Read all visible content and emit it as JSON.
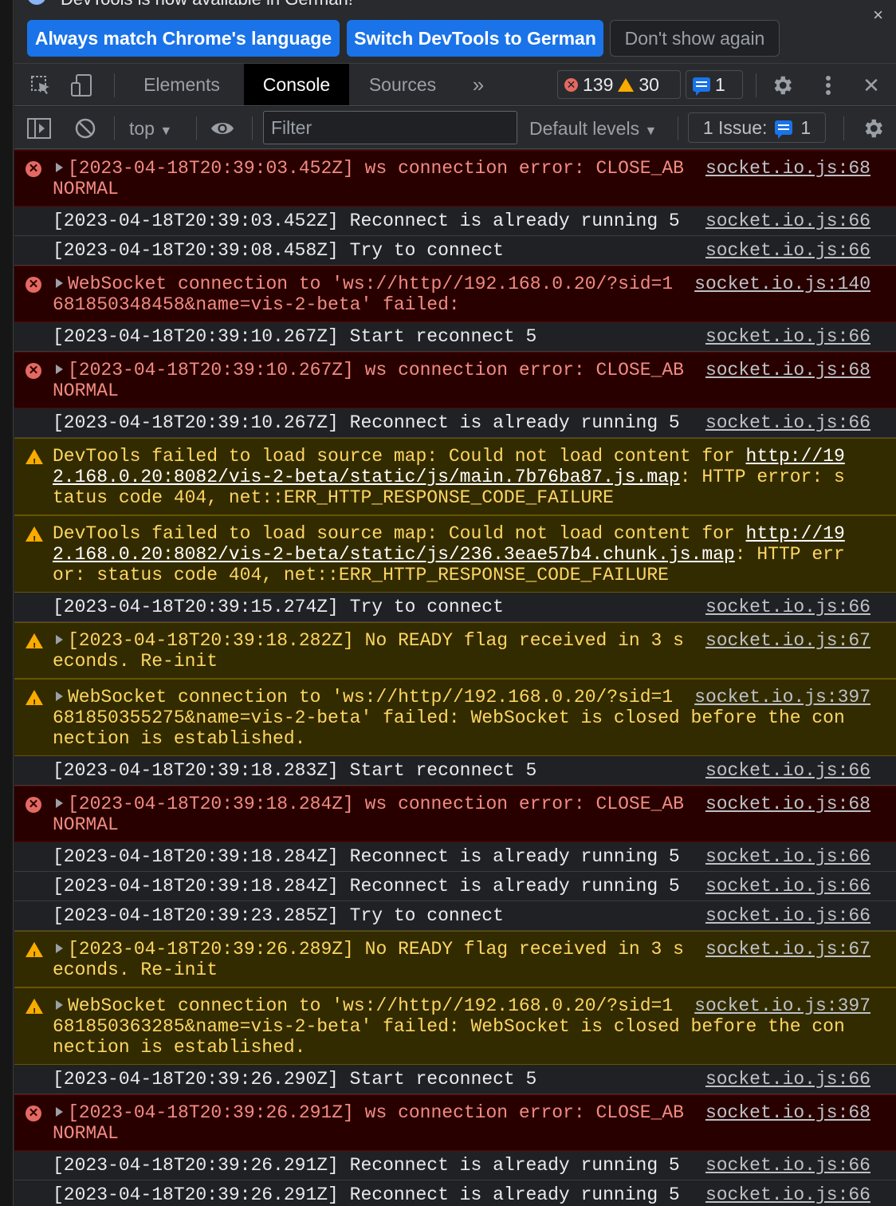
{
  "infobar": {
    "message": "DevTools is now available in German!",
    "buttons": {
      "match": "Always match Chrome's language",
      "switch": "Switch DevTools to German",
      "dismiss": "Don't show again"
    },
    "close_glyph": "×"
  },
  "toolbar": {
    "tabs": [
      "Elements",
      "Console",
      "Sources"
    ],
    "more_tabs_glyph": "»",
    "error_count": "139",
    "warning_count": "30",
    "issue_count": "1",
    "close_glyph": "✕"
  },
  "console_toolbar": {
    "context": "top",
    "filter_placeholder": "Filter",
    "levels": "Default levels",
    "issues_label": "1 Issue:",
    "issues_count": "1"
  },
  "colors": {
    "error_bg": "#290000",
    "error_text": "#f28b82",
    "warning_bg": "#332b00",
    "warning_text": "#fdd663",
    "accent": "#1a73e8"
  },
  "messages": [
    {
      "level": "error",
      "expandable": true,
      "text": "[2023-04-18T20:39:03.452Z] ws connection error: CLOSE_ABNORMAL",
      "source": "socket.io.js:68"
    },
    {
      "level": "log",
      "expandable": false,
      "text": "[2023-04-18T20:39:03.452Z] Reconnect is already running 5",
      "source": "socket.io.js:66"
    },
    {
      "level": "log",
      "expandable": false,
      "text": "[2023-04-18T20:39:08.458Z] Try to connect",
      "source": "socket.io.js:66"
    },
    {
      "level": "error",
      "expandable": true,
      "text": "WebSocket connection to 'ws://http//192.168.0.20/?sid=1681850348458&name=vis-2-beta' failed:",
      "source": "socket.io.js:140"
    },
    {
      "level": "log",
      "expandable": false,
      "text": "[2023-04-18T20:39:10.267Z] Start reconnect 5",
      "source": "socket.io.js:66"
    },
    {
      "level": "error",
      "expandable": true,
      "text": "[2023-04-18T20:39:10.267Z] ws connection error: CLOSE_ABNORMAL",
      "source": "socket.io.js:68"
    },
    {
      "level": "log",
      "expandable": false,
      "text": "[2023-04-18T20:39:10.267Z] Reconnect is already running 5",
      "source": "socket.io.js:66"
    },
    {
      "level": "warning",
      "expandable": false,
      "text": "DevTools failed to load source map: Could not load content for ",
      "link": "http://192.168.0.20:8082/vis-2-beta/static/js/main.7b76ba87.js.map",
      "suffix": ": HTTP error: status code 404, net::ERR_HTTP_RESPONSE_CODE_FAILURE",
      "source": ""
    },
    {
      "level": "warning",
      "expandable": false,
      "text": "DevTools failed to load source map: Could not load content for ",
      "link": "http://192.168.0.20:8082/vis-2-beta/static/js/236.3eae57b4.chunk.js.map",
      "suffix": ": HTTP error: status code 404, net::ERR_HTTP_RESPONSE_CODE_FAILURE",
      "source": ""
    },
    {
      "level": "log",
      "expandable": false,
      "text": "[2023-04-18T20:39:15.274Z] Try to connect",
      "source": "socket.io.js:66"
    },
    {
      "level": "warning",
      "expandable": true,
      "text": "[2023-04-18T20:39:18.282Z] No READY flag received in 3 seconds. Re-init",
      "source": "socket.io.js:67"
    },
    {
      "level": "warning",
      "expandable": true,
      "text": "WebSocket connection to 'ws://http//192.168.0.20/?sid=1681850355275&name=vis-2-beta' failed: WebSocket is closed before the connection is established.",
      "source": "socket.io.js:397"
    },
    {
      "level": "log",
      "expandable": false,
      "text": "[2023-04-18T20:39:18.283Z] Start reconnect 5",
      "source": "socket.io.js:66"
    },
    {
      "level": "error",
      "expandable": true,
      "text": "[2023-04-18T20:39:18.284Z] ws connection error: CLOSE_ABNORMAL",
      "source": "socket.io.js:68"
    },
    {
      "level": "log",
      "expandable": false,
      "text": "[2023-04-18T20:39:18.284Z] Reconnect is already running 5",
      "source": "socket.io.js:66"
    },
    {
      "level": "log",
      "expandable": false,
      "text": "[2023-04-18T20:39:18.284Z] Reconnect is already running 5",
      "source": "socket.io.js:66"
    },
    {
      "level": "log",
      "expandable": false,
      "text": "[2023-04-18T20:39:23.285Z] Try to connect",
      "source": "socket.io.js:66"
    },
    {
      "level": "warning",
      "expandable": true,
      "text": "[2023-04-18T20:39:26.289Z] No READY flag received in 3 seconds. Re-init",
      "source": "socket.io.js:67"
    },
    {
      "level": "warning",
      "expandable": true,
      "text": "WebSocket connection to 'ws://http//192.168.0.20/?sid=1681850363285&name=vis-2-beta' failed: WebSocket is closed before the connection is established.",
      "source": "socket.io.js:397"
    },
    {
      "level": "log",
      "expandable": false,
      "text": "[2023-04-18T20:39:26.290Z] Start reconnect 5",
      "source": "socket.io.js:66"
    },
    {
      "level": "error",
      "expandable": true,
      "text": "[2023-04-18T20:39:26.291Z] ws connection error: CLOSE_ABNORMAL",
      "source": "socket.io.js:68"
    },
    {
      "level": "log",
      "expandable": false,
      "text": "[2023-04-18T20:39:26.291Z] Reconnect is already running 5",
      "source": "socket.io.js:66"
    },
    {
      "level": "log",
      "expandable": false,
      "text": "[2023-04-18T20:39:26.291Z] Reconnect is already running 5",
      "source": "socket.io.js:66"
    }
  ],
  "prompt_glyph": "›"
}
